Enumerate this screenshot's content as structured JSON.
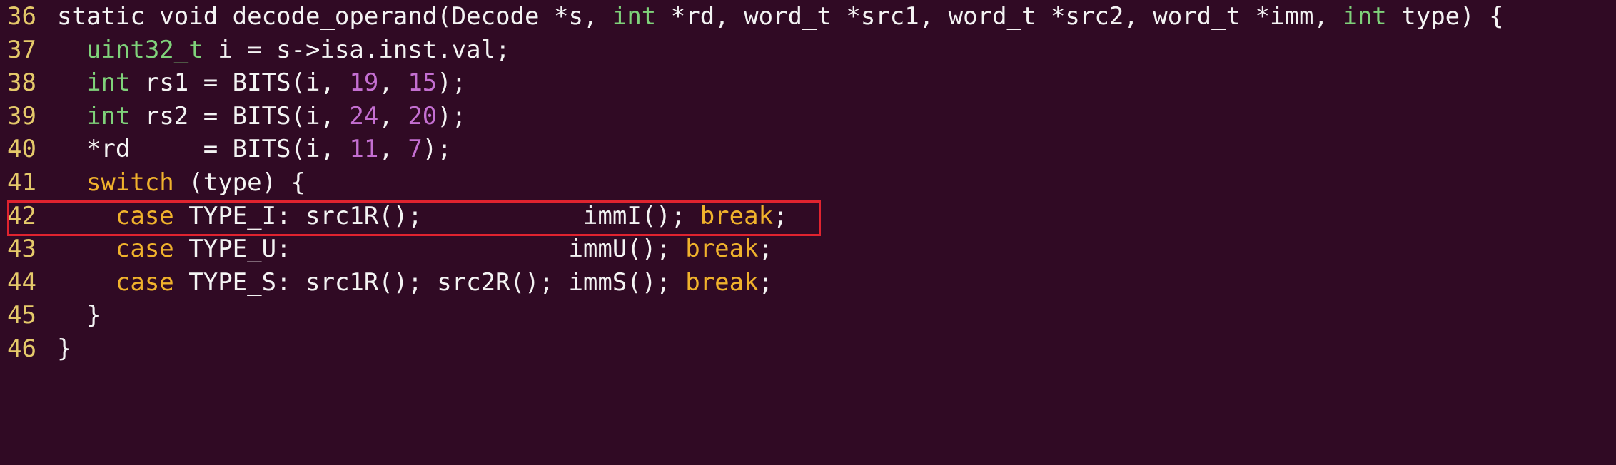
{
  "editor": {
    "highlight_color": "#e0232f",
    "colors": {
      "background": "#300a24",
      "text": "#f3f3f3",
      "line_number": "#e5c96a",
      "keyword": "#f0b22c",
      "type": "#7fd27a",
      "number": "#c46fd1"
    },
    "lines": [
      {
        "num": "36",
        "parts": [
          "static void decode_operand(Decode *s, ",
          "int",
          " *rd, word_t *src1, word_t *src2, word_t *imm, ",
          "int",
          " type) {"
        ]
      },
      {
        "num": "37",
        "parts": [
          "  ",
          "uint32_t",
          " i = s->isa.inst.val;"
        ]
      },
      {
        "num": "38",
        "parts": [
          "  ",
          "int",
          " rs1 = BITS(i, ",
          "19",
          ", ",
          "15",
          ");"
        ]
      },
      {
        "num": "39",
        "parts": [
          "  ",
          "int",
          " rs2 = BITS(i, ",
          "24",
          ", ",
          "20",
          ");"
        ]
      },
      {
        "num": "40",
        "parts": [
          "  *rd     = BITS(i, ",
          "11",
          ", ",
          "7",
          ");"
        ]
      },
      {
        "num": "41",
        "parts": [
          "  ",
          "switch",
          " (type) {"
        ]
      },
      {
        "num": "42",
        "parts": [
          "    ",
          "case",
          " TYPE_I: src1R();           immI(); ",
          "break",
          ";"
        ]
      },
      {
        "num": "43",
        "parts": [
          "    ",
          "case",
          " TYPE_U:                   immU(); ",
          "break",
          ";"
        ]
      },
      {
        "num": "44",
        "parts": [
          "    ",
          "case",
          " TYPE_S: src1R(); src2R(); immS(); ",
          "break",
          ";"
        ]
      },
      {
        "num": "45",
        "parts": [
          "  }"
        ]
      },
      {
        "num": "46",
        "parts": [
          "}"
        ]
      }
    ]
  }
}
